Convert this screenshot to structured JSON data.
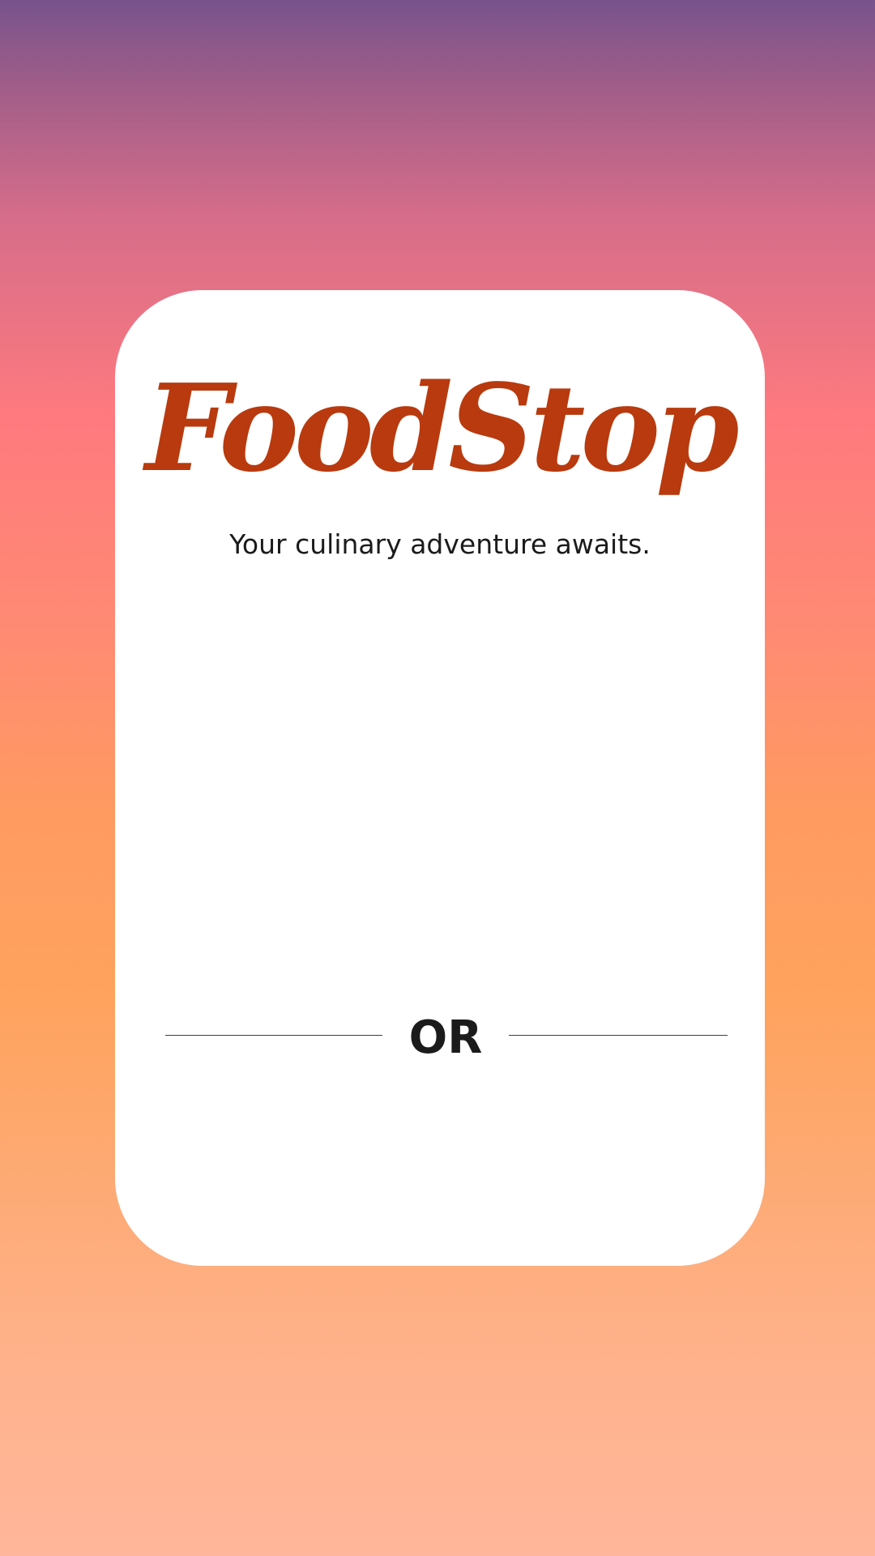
{
  "app": {
    "logo_text": "FoodStop",
    "tagline": "Your culinary adventure awaits."
  },
  "auth": {
    "separator_label": "OR"
  },
  "colors": {
    "brand": "#b83a0e",
    "card_background": "#ffffff",
    "text": "#1b1b1b",
    "gradient_top": "#77538c",
    "gradient_mid": "#ff7a7e",
    "gradient_bottom": "#ffb69a"
  }
}
